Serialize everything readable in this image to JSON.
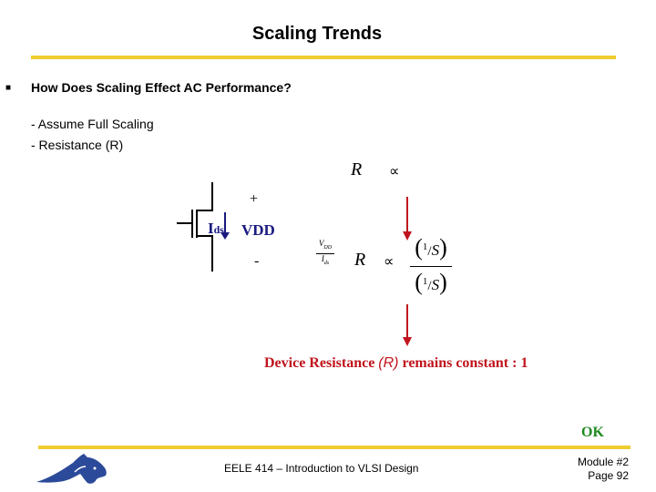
{
  "slide": {
    "title": "Scaling Trends",
    "bullet": "How Does Scaling Effect AC Performance?",
    "sub_items": [
      "- Assume Full Scaling",
      "- Resistance  (R)"
    ]
  },
  "diagram": {
    "plus_label": "+",
    "minus_label": "-",
    "current_label": "I",
    "current_sub": "ds",
    "voltage_label": "VDD",
    "eq1": {
      "lhs": "R",
      "relation": "∝"
    },
    "eq2": {
      "ratio_num": "V",
      "ratio_num_sub": "DD",
      "ratio_den": "I",
      "ratio_den_sub": "ds",
      "lhs": "R",
      "relation": "∝",
      "numerator": "(1/S)",
      "denominator": "(1/S)",
      "frac_one": "1",
      "frac_s": "S"
    },
    "result": {
      "prefix": "Device Resistance ",
      "symbol": "(R)",
      "suffix": " remains constant : 1"
    },
    "ok_label": "OK",
    "colors": {
      "arrow": "#c0141c",
      "current": "#1a1a80",
      "ok": "#1e8a1e",
      "rule": "#f0cc2e"
    }
  },
  "footer": {
    "course": "EELE 414 – Introduction to VLSI Design",
    "module": "Module #2",
    "page": "Page 92",
    "logo": "bobcat-logo"
  }
}
